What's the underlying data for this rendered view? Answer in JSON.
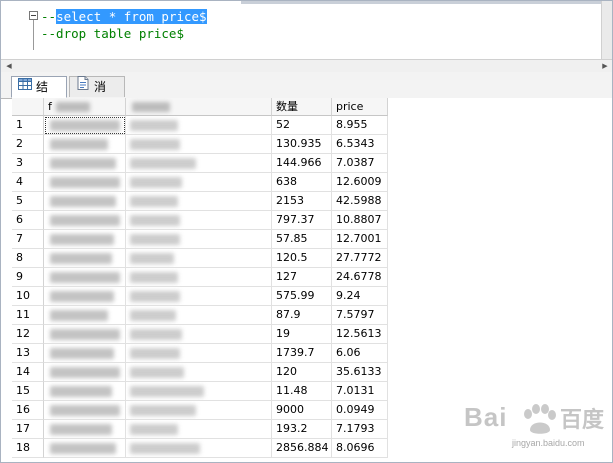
{
  "editor": {
    "line1_prefix": "--",
    "line1_selected": "select * from price$",
    "line2": "--drop table price$"
  },
  "tabs": [
    {
      "label": "结果",
      "icon": "grid-table-icon",
      "active": true
    },
    {
      "label": "消息",
      "icon": "messages-document-icon",
      "active": false
    }
  ],
  "grid": {
    "columns": [
      {
        "label": "f"
      },
      {
        "label": ""
      },
      {
        "label": "数量"
      },
      {
        "label": "price"
      }
    ],
    "rows": [
      {
        "n": "1",
        "qty": "52",
        "price": "8.955"
      },
      {
        "n": "2",
        "qty": "130.935",
        "price": "6.5343"
      },
      {
        "n": "3",
        "qty": "144.966",
        "price": "7.0387"
      },
      {
        "n": "4",
        "qty": "638",
        "price": "12.6009"
      },
      {
        "n": "5",
        "qty": "2153",
        "price": "42.5988"
      },
      {
        "n": "6",
        "qty": "797.37",
        "price": "10.8807"
      },
      {
        "n": "7",
        "qty": "57.85",
        "price": "12.7001"
      },
      {
        "n": "8",
        "qty": "120.5",
        "price": "27.7772"
      },
      {
        "n": "9",
        "qty": "127",
        "price": "24.6778"
      },
      {
        "n": "10",
        "qty": "575.99",
        "price": "9.24"
      },
      {
        "n": "11",
        "qty": "87.9",
        "price": "7.5797"
      },
      {
        "n": "12",
        "qty": "19",
        "price": "12.5613"
      },
      {
        "n": "13",
        "qty": "1739.7",
        "price": "6.06"
      },
      {
        "n": "14",
        "qty": "120",
        "price": "35.6133"
      },
      {
        "n": "15",
        "qty": "11.48",
        "price": "7.0131"
      },
      {
        "n": "16",
        "qty": "9000",
        "price": "0.0949"
      },
      {
        "n": "17",
        "qty": "193.2",
        "price": "7.1793"
      },
      {
        "n": "18",
        "qty": "2856.884",
        "price": "8.0696"
      }
    ]
  },
  "watermark": {
    "text": "Bai",
    "sub": "jingyan.baidu.com"
  },
  "colors": {
    "selection": "#3399ff",
    "comment": "#008000"
  }
}
